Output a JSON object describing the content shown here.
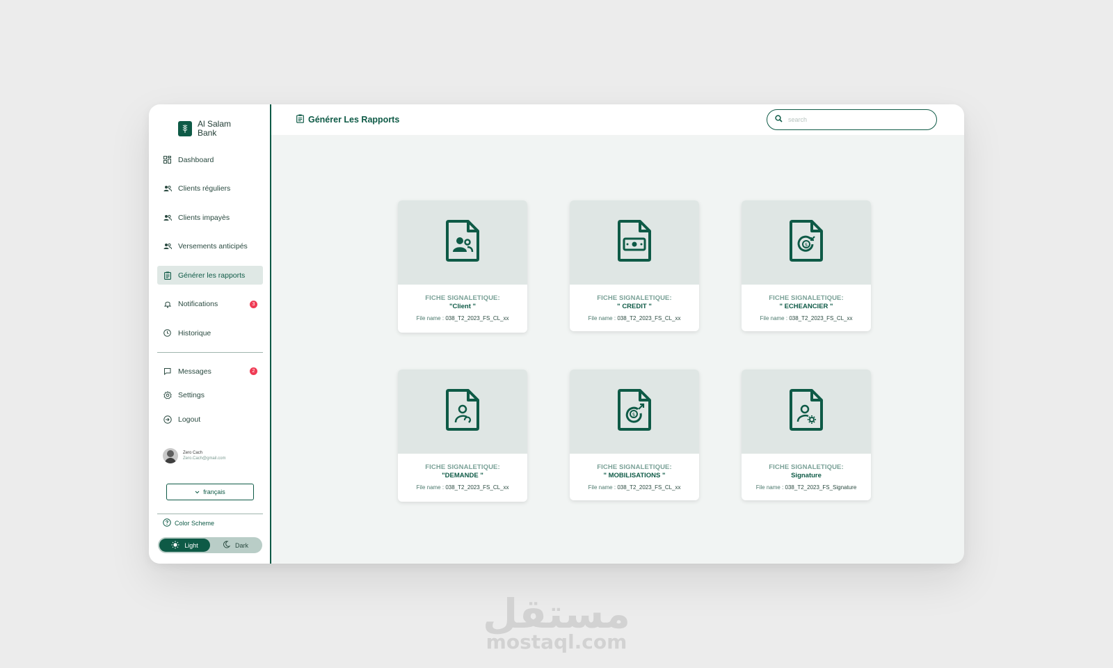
{
  "brand": {
    "line1": "Al Salam",
    "line2": "Bank"
  },
  "sidebar": {
    "items": [
      {
        "label": "Dashboard",
        "icon": "dashboard-icon"
      },
      {
        "label": "Clients réguliers",
        "icon": "users-icon"
      },
      {
        "label": "Clients impayès",
        "icon": "users-icon"
      },
      {
        "label": "Versements anticipés",
        "icon": "users-icon"
      },
      {
        "label": "Générer les rapports",
        "icon": "clipboard-icon",
        "active": true
      },
      {
        "label": "Notifications",
        "icon": "bell-icon",
        "badge": "3"
      },
      {
        "label": "Historique",
        "icon": "clock-icon"
      }
    ],
    "secondary": [
      {
        "label": "Messages",
        "icon": "message-icon",
        "badge": "2"
      },
      {
        "label": "Settings",
        "icon": "gear-icon"
      },
      {
        "label": "Logout",
        "icon": "logout-icon"
      }
    ],
    "profile": {
      "name": "Zero Cach",
      "email": "Zero.Cach@gmail.com"
    },
    "language": "français",
    "color_scheme_label": "Color Scheme",
    "theme": {
      "light": "Light",
      "dark": "Dark",
      "selected": "Light"
    }
  },
  "header": {
    "title": "Générer Les Rapports",
    "search_placeholder": "search"
  },
  "cards": [
    {
      "heading": "FICHE SIGNALETIQUE:",
      "name": "\"Client \"",
      "file_label": "File name :",
      "file_name": "038_T2_2023_FS_CL_xx",
      "icon": "client-file-icon"
    },
    {
      "heading": "FICHE SIGNALETIQUE:",
      "name": "\" CREDIT \"",
      "file_label": "File name :",
      "file_name": "038_T2_2023_FS_CL_xx",
      "icon": "credit-file-icon"
    },
    {
      "heading": "FICHE SIGNALETIQUE:",
      "name": "\" ECHEANCIER \"",
      "file_label": "File name :",
      "file_name": "038_T2_2023_FS_CL_xx",
      "icon": "schedule-file-icon"
    },
    {
      "heading": "FICHE SIGNALETIQUE:",
      "name": "\"DEMANDE \"",
      "file_label": "File name :",
      "file_name": "038_T2_2023_FS_CL_xx",
      "icon": "request-file-icon"
    },
    {
      "heading": "FICHE SIGNALETIQUE:",
      "name": "\" MOBILISATIONS \"",
      "file_label": "File name :",
      "file_name": "038_T2_2023_FS_CL_xx",
      "icon": "mobilisation-file-icon"
    },
    {
      "heading": "FICHE SIGNALETIQUE:",
      "name": "Signature",
      "file_label": "File name :",
      "file_name": "038_T2_2023_FS_Signature",
      "icon": "signature-file-icon"
    }
  ],
  "watermark": {
    "arabic": "مستقل",
    "latin": "mostaql.com"
  },
  "colors": {
    "primary": "#0e5a46",
    "badge": "#ef3b54",
    "card_top": "#dfe6e4",
    "background": "#f1f4f3"
  }
}
